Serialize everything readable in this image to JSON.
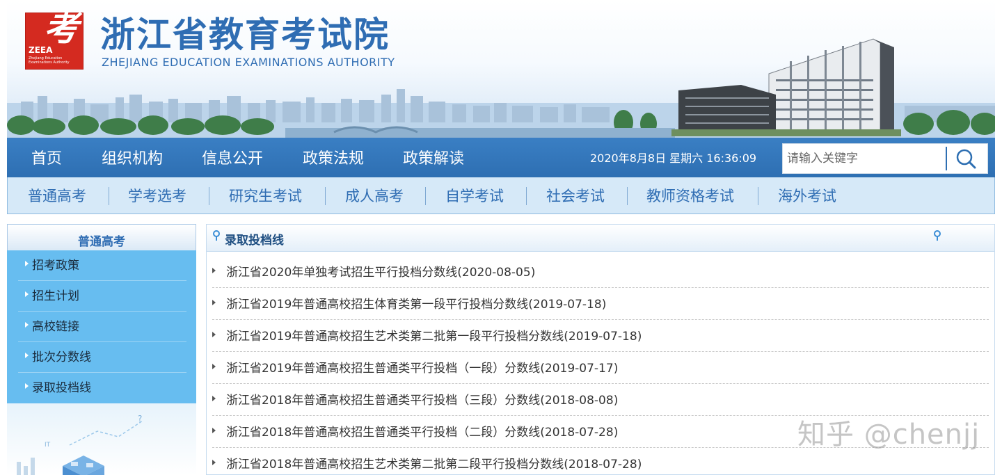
{
  "header": {
    "logo_abbr": "ZEEA",
    "logo_subtext": "Zhejiang Education Examinations Authority",
    "title_cn": "浙江省教育考试院",
    "title_en": "ZHEJIANG EDUCATION EXAMINATIONS AUTHORITY"
  },
  "main_nav": {
    "items": [
      "首页",
      "组织机构",
      "信息公开",
      "政策法规",
      "政策解读"
    ],
    "datetime": "2020年8月8日 星期六 16:36:09",
    "search_placeholder": "请输入关键字"
  },
  "sub_nav": {
    "items": [
      "普通高考",
      "学考选考",
      "研究生考试",
      "成人高考",
      "自学考试",
      "社会考试",
      "教师资格考试",
      "海外考试"
    ]
  },
  "sidebar": {
    "title": "普通高考",
    "items": [
      "招考政策",
      "招生计划",
      "高校链接",
      "批次分数线",
      "录取投档线"
    ]
  },
  "content": {
    "title": "录取投档线",
    "items": [
      "浙江省2020年单独考试招生平行投档分数线(2020-08-05)",
      "浙江省2019年普通高校招生体育类第一段平行投档分数线(2019-07-18)",
      "浙江省2019年普通高校招生艺术类第二批第一段平行投档分数线(2019-07-18)",
      "浙江省2019年普通高校招生普通类平行投档（一段）分数线(2019-07-17)",
      "浙江省2018年普通高校招生普通类平行投档（三段）分数线(2018-08-08)",
      "浙江省2018年普通高校招生普通类平行投档（二段）分数线(2018-07-28)",
      "浙江省2018年普通高校招生艺术类第二批第二段平行投档分数线(2018-07-28)"
    ]
  },
  "watermark": "知乎 @chenjj",
  "colors": {
    "brand_blue": "#2f6db3",
    "nav_blue": "#3a7fc4",
    "sidebar_blue": "#67bdf0",
    "logo_red": "#d42a20"
  }
}
